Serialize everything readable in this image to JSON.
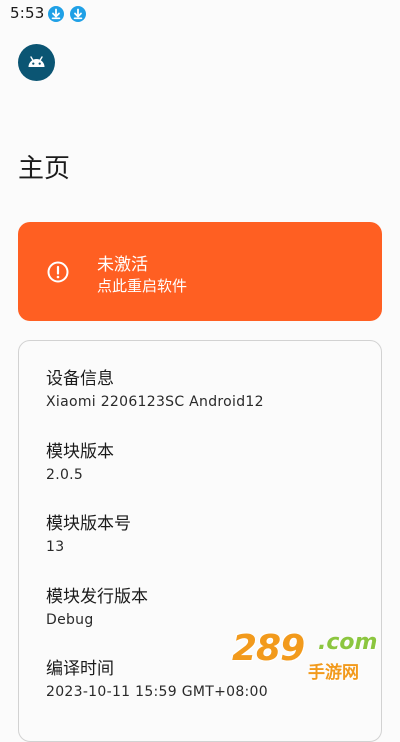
{
  "status_bar": {
    "time": "5:53",
    "notification_icons": [
      "download-icon",
      "download-icon"
    ],
    "icon_color": "#1fa0e6"
  },
  "app": {
    "avatar_icon": "android-robot-icon",
    "avatar_color": "#0b5573"
  },
  "page": {
    "title": "主页"
  },
  "activation_card": {
    "title": "未激活",
    "subtitle": "点此重启软件",
    "icon": "alert-circle-icon",
    "background_color": "#ff5f22"
  },
  "info": {
    "items": [
      {
        "label": "设备信息",
        "value": "Xiaomi 2206123SC Android12"
      },
      {
        "label": "模块版本",
        "value": "2.0.5"
      },
      {
        "label": "模块版本号",
        "value": "13"
      },
      {
        "label": "模块发行版本",
        "value": "Debug"
      },
      {
        "label": "编译时间",
        "value": "2023-10-11 15:59 GMT+08:00"
      }
    ]
  },
  "watermark": {
    "number": "289",
    "domain": ".com",
    "brand": "手游网"
  }
}
